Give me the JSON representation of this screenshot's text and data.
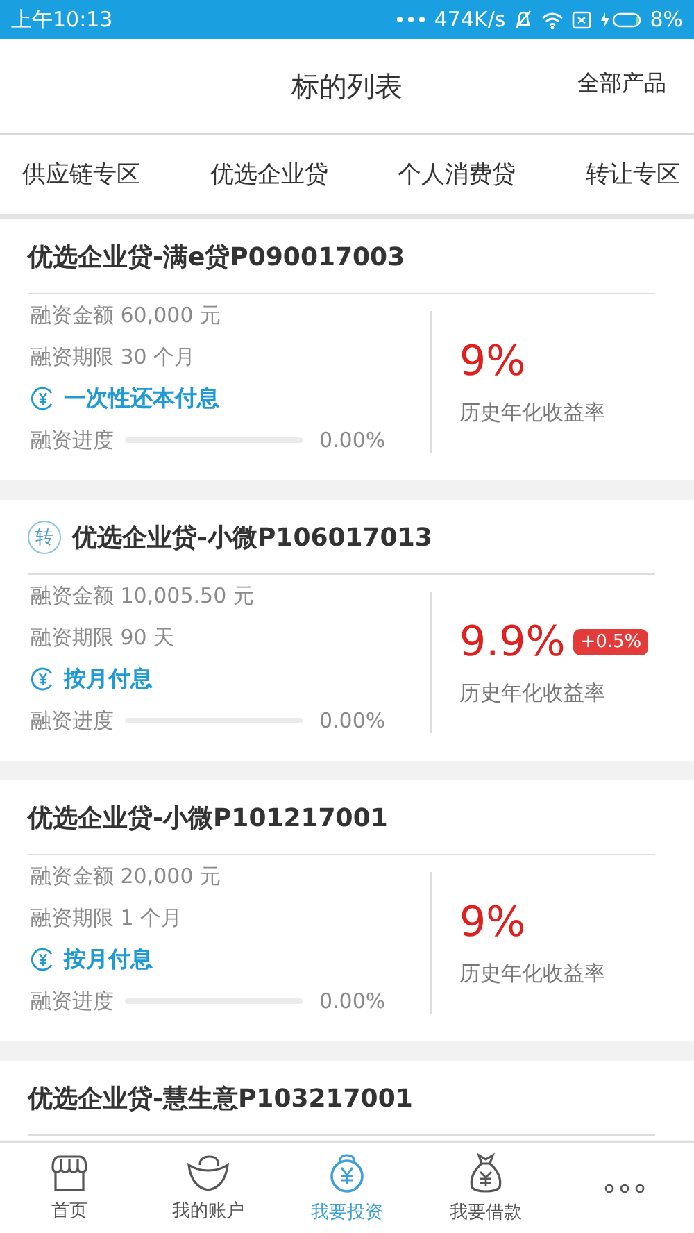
{
  "status_bar": {
    "time": "上午10:13",
    "speed": "474K/s",
    "battery": "8%"
  },
  "header": {
    "title": "标的列表",
    "action": "全部产品"
  },
  "tabs": [
    {
      "label": "供应链专区",
      "selected": false
    },
    {
      "label": "优选企业贷",
      "selected": false
    },
    {
      "label": "个人消费贷",
      "selected": false
    },
    {
      "label": "转让专区",
      "selected": false
    }
  ],
  "loans": [
    {
      "title": "优选企业贷-满e贷P090017003",
      "amount": "融资金额 60,000 元",
      "term": "融资期限 30 个月",
      "repayment": "一次性还本付息",
      "progress_label": "融资进度",
      "level": 0,
      "progress": "0.00%",
      "rate": "9%",
      "rate_label": "历史年化收益率"
    },
    {
      "tag": "转",
      "title": "优选企业贷-小微P106017013",
      "amount": "融资金额 10,005.50 元",
      "term": "融资期限 90 天",
      "repayment": "按月付息",
      "progress_label": "融资进度",
      "level": 0,
      "progress": "0.00%",
      "rate": "9.9%",
      "bonus": "+0.5%",
      "rate_label": "历史年化收益率"
    },
    {
      "title": "优选企业贷-小微P101217001",
      "amount": "融资金额 20,000 元",
      "term": "融资期限 1 个月",
      "repayment": "按月付息",
      "progress_label": "融资进度",
      "level": 0,
      "progress": "0.00%",
      "rate": "9%",
      "rate_label": "历史年化收益率"
    },
    {
      "title": "优选企业贷-慧生意P103217001"
    }
  ],
  "nav": [
    {
      "kind": "home",
      "label": "首页",
      "selected": false
    },
    {
      "kind": "account",
      "label": "我的账户",
      "selected": false
    },
    {
      "kind": "invest",
      "label": "我要投资",
      "selected": true
    },
    {
      "kind": "loan",
      "label": "我要借款",
      "selected": false
    },
    {
      "kind": "more",
      "selected": false
    }
  ]
}
